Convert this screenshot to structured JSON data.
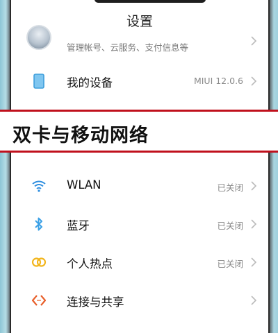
{
  "header": {
    "title": "设置"
  },
  "account": {
    "subtitle": "管理帐号、云服务、支付信息等"
  },
  "my_device": {
    "label": "我的设备",
    "value": "MIUI 12.0.6"
  },
  "banner": {
    "text": "双卡与移动网络"
  },
  "network_items": [
    {
      "label": "WLAN",
      "value": "已关闭",
      "icon": "wifi-icon",
      "color": "#2f8fe0"
    },
    {
      "label": "蓝牙",
      "value": "已关闭",
      "icon": "bluetooth-icon",
      "color": "#3aa0e6"
    },
    {
      "label": "个人热点",
      "value": "已关闭",
      "icon": "hotspot-icon",
      "color": "#f2b51c"
    },
    {
      "label": "连接与共享",
      "value": "",
      "icon": "connection-share-icon",
      "color": "#e8602c"
    }
  ]
}
